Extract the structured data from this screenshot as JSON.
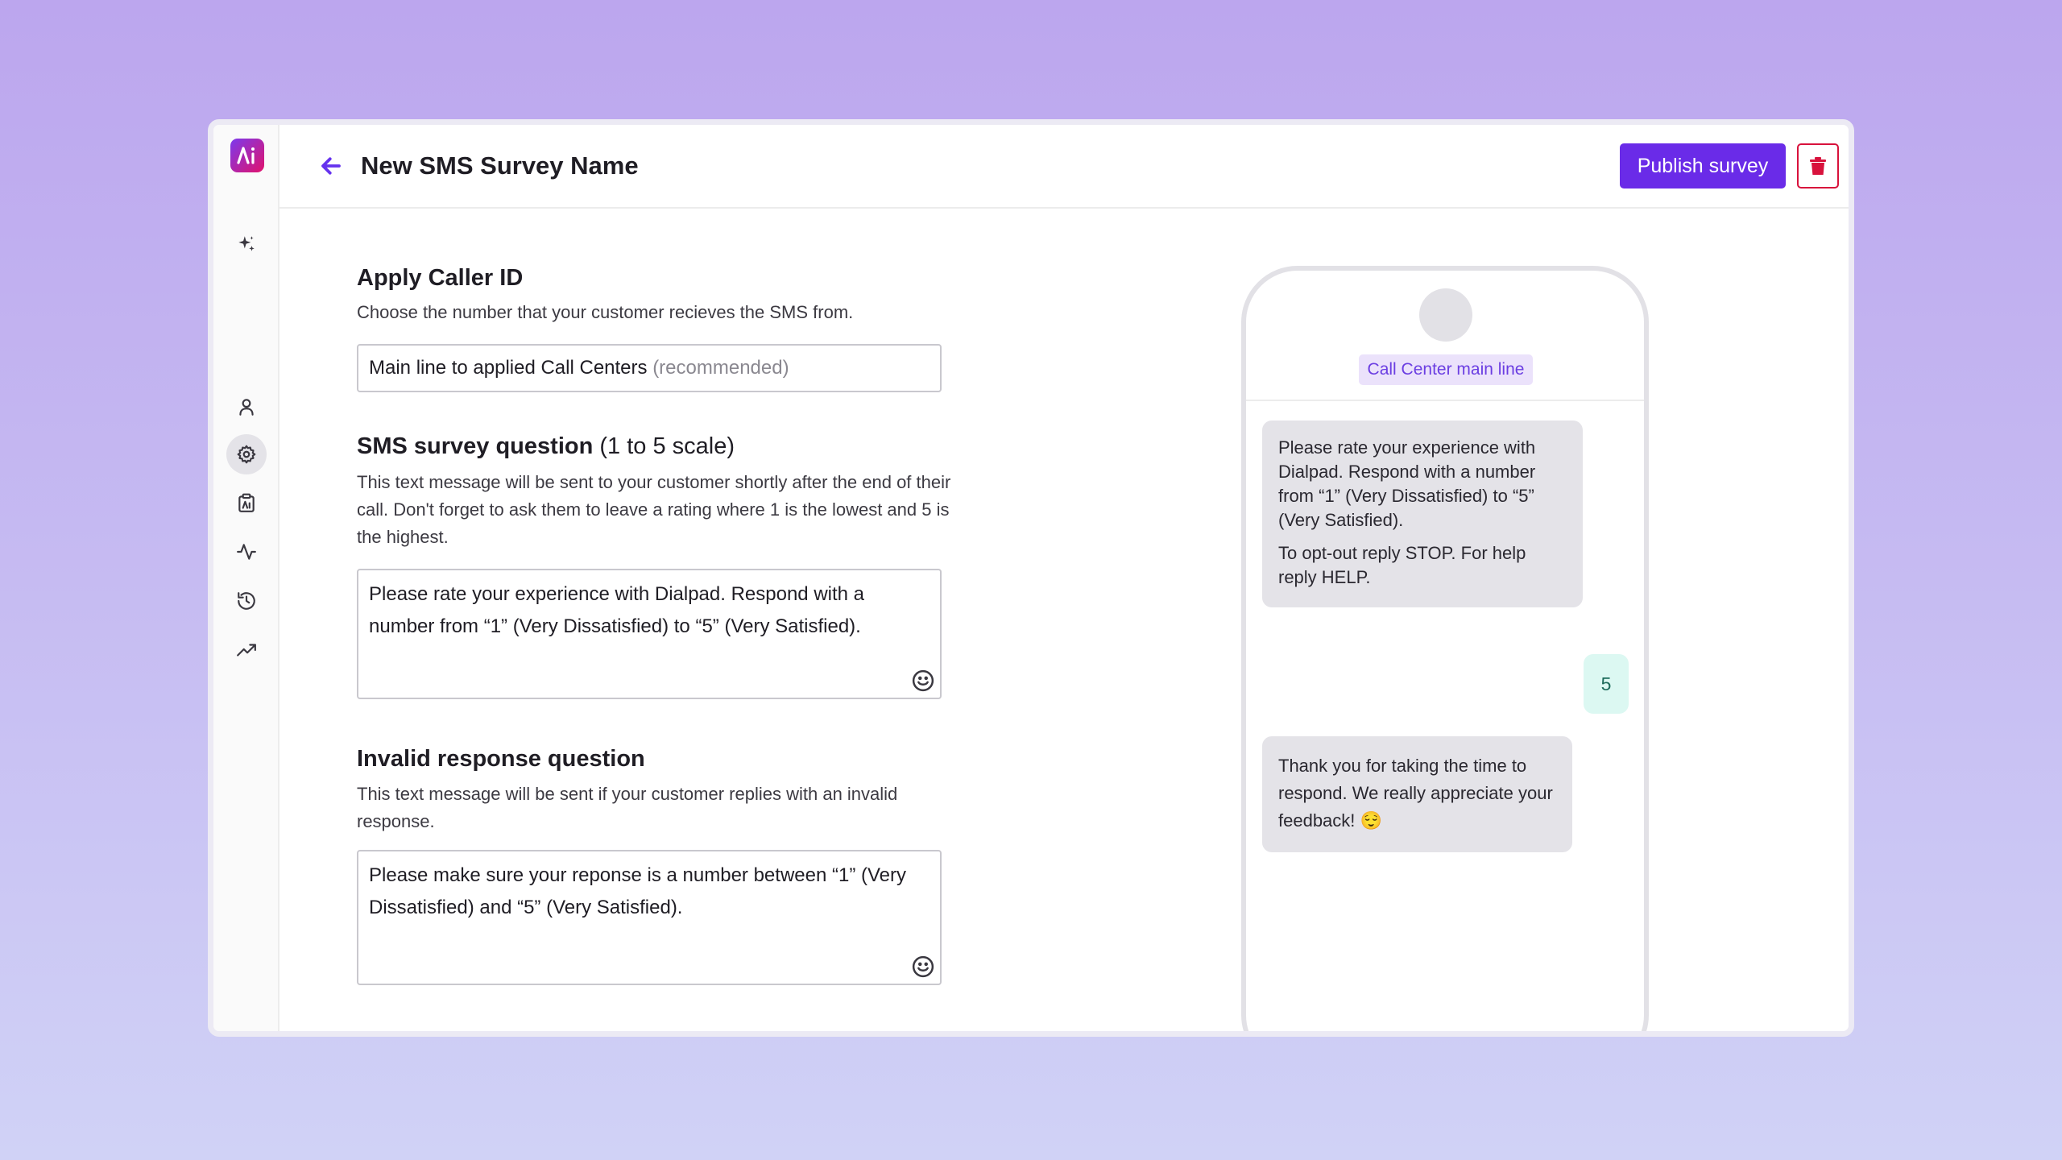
{
  "header": {
    "title": "New SMS Survey Name",
    "publish_label": "Publish survey"
  },
  "caller_id": {
    "title": "Apply Caller ID",
    "description": "Choose the number that your customer recieves the SMS from.",
    "value": "Main line to applied Call Centers",
    "hint": "(recommended)"
  },
  "survey_question": {
    "title": "SMS survey question",
    "title_suffix": "(1 to 5 scale)",
    "description": "This text message will be sent to your customer shortly after the end of their call. Don't forget to ask them to leave a rating where 1 is the lowest and 5 is the highest.",
    "value": "Please rate your experience with Dialpad. Respond with a number from “1” (Very Dissatisfied)  to “5” (Very Satisfied)."
  },
  "invalid_response": {
    "title": "Invalid response question",
    "description": "This text message will be sent if your customer replies with an invalid response.",
    "value": "Please make sure your reponse is a number between “1” (Very Dissatisfied) and “5” (Very Satisfied)."
  },
  "phone_preview": {
    "contact_name": "Call Center main line",
    "message_1": "Please rate your experience with Dialpad. Respond with a number from “1” (Very Dissatisfied)  to “5” (Very Satisfied).",
    "message_1_optout": "To opt-out reply STOP. For help reply HELP.",
    "reply": "5",
    "message_2": "Thank you for taking the time to respond. We really appreciate your feedback! 😌"
  },
  "colors": {
    "accent": "#6a2be8",
    "danger": "#d8123c",
    "reply_bubble": "#dcf8f2",
    "incoming_bubble": "#e4e3e8"
  },
  "sidebar": {
    "icons": [
      "ai-sparkle-icon",
      "user-icon",
      "gear-icon",
      "clipboard-icon",
      "activity-icon",
      "history-icon",
      "trending-icon"
    ],
    "active": "gear-icon"
  }
}
